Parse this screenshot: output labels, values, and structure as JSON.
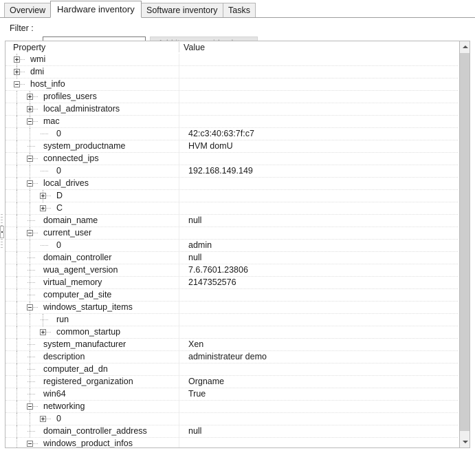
{
  "tabs": [
    {
      "label": "Overview",
      "active": false
    },
    {
      "label": "Hardware inventory",
      "active": true
    },
    {
      "label": "Software inventory",
      "active": false
    },
    {
      "label": "Tasks",
      "active": false
    }
  ],
  "toolbar": {
    "filter_label": "Filter :",
    "filter_value": "",
    "filter_placeholder": "",
    "add_column_label": "Add item as grid column",
    "add_column_enabled": false
  },
  "grid": {
    "columns": [
      "Property",
      "Value"
    ],
    "rows": [
      {
        "depth": 0,
        "state": "collapsed",
        "property": "wmi",
        "value": ""
      },
      {
        "depth": 0,
        "state": "collapsed",
        "property": "dmi",
        "value": ""
      },
      {
        "depth": 0,
        "state": "expanded",
        "property": "host_info",
        "value": ""
      },
      {
        "depth": 1,
        "state": "collapsed",
        "property": "profiles_users",
        "value": ""
      },
      {
        "depth": 1,
        "state": "collapsed",
        "property": "local_administrators",
        "value": ""
      },
      {
        "depth": 1,
        "state": "expanded",
        "property": "mac",
        "value": ""
      },
      {
        "depth": 2,
        "state": "leaf",
        "property": "0",
        "value": "42:c3:40:63:7f:c7"
      },
      {
        "depth": 1,
        "state": "leaf",
        "property": "system_productname",
        "value": "HVM domU"
      },
      {
        "depth": 1,
        "state": "expanded",
        "property": "connected_ips",
        "value": ""
      },
      {
        "depth": 2,
        "state": "leaf",
        "property": "0",
        "value": "192.168.149.149"
      },
      {
        "depth": 1,
        "state": "expanded",
        "property": "local_drives",
        "value": ""
      },
      {
        "depth": 2,
        "state": "collapsed",
        "property": "D",
        "value": ""
      },
      {
        "depth": 2,
        "state": "collapsed",
        "property": "C",
        "value": ""
      },
      {
        "depth": 1,
        "state": "leaf",
        "property": "domain_name",
        "value": "null"
      },
      {
        "depth": 1,
        "state": "expanded",
        "property": "current_user",
        "value": ""
      },
      {
        "depth": 2,
        "state": "leaf",
        "property": "0",
        "value": "admin"
      },
      {
        "depth": 1,
        "state": "leaf",
        "property": "domain_controller",
        "value": "null"
      },
      {
        "depth": 1,
        "state": "leaf",
        "property": "wua_agent_version",
        "value": "7.6.7601.23806"
      },
      {
        "depth": 1,
        "state": "leaf",
        "property": "virtual_memory",
        "value": "2147352576"
      },
      {
        "depth": 1,
        "state": "leaf",
        "property": "computer_ad_site",
        "value": ""
      },
      {
        "depth": 1,
        "state": "expanded",
        "property": "windows_startup_items",
        "value": ""
      },
      {
        "depth": 2,
        "state": "leaf",
        "property": "run",
        "value": ""
      },
      {
        "depth": 2,
        "state": "collapsed",
        "property": "common_startup",
        "value": ""
      },
      {
        "depth": 1,
        "state": "leaf",
        "property": "system_manufacturer",
        "value": "Xen"
      },
      {
        "depth": 1,
        "state": "leaf",
        "property": "description",
        "value": "administrateur demo"
      },
      {
        "depth": 1,
        "state": "leaf",
        "property": "computer_ad_dn",
        "value": ""
      },
      {
        "depth": 1,
        "state": "leaf",
        "property": "registered_organization",
        "value": "Orgname"
      },
      {
        "depth": 1,
        "state": "leaf",
        "property": "win64",
        "value": "True"
      },
      {
        "depth": 1,
        "state": "expanded",
        "property": "networking",
        "value": ""
      },
      {
        "depth": 2,
        "state": "collapsed",
        "property": "0",
        "value": ""
      },
      {
        "depth": 1,
        "state": "leaf",
        "property": "domain_controller_address",
        "value": "null"
      },
      {
        "depth": 1,
        "state": "expanded",
        "property": "windows_product_infos",
        "value": ""
      }
    ]
  },
  "scrollbar": {
    "up_icon": "chevron-up-icon",
    "down_icon": "chevron-down-icon"
  },
  "colors": {
    "text": "#1a1a1a",
    "disabled_text": "#9a9a9a",
    "border": "#b9b9b9",
    "tab_inactive_bg": "#f0f0f0",
    "scroll_thumb": "#cdcdcd"
  }
}
